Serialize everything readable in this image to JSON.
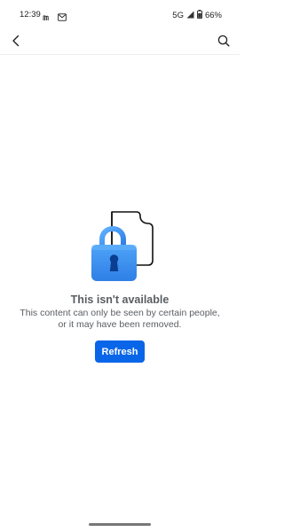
{
  "status_bar": {
    "time": "12:39",
    "network": "5G",
    "battery": "66%",
    "notification_icons": [
      "m-app-icon",
      "gmail-icon"
    ]
  },
  "app_bar": {
    "back_icon": "chevron-left-icon",
    "search_icon": "search-icon"
  },
  "empty_state": {
    "illustration": "padlock-document-illustration",
    "title": "This isn't available",
    "message": "This content can only be seen by certain people, or it may have been removed.",
    "refresh_label": "Refresh"
  },
  "colors": {
    "accent": "#0a66e9",
    "lock_blue": "#3b8ff0",
    "text_secondary": "#5a5d62"
  }
}
